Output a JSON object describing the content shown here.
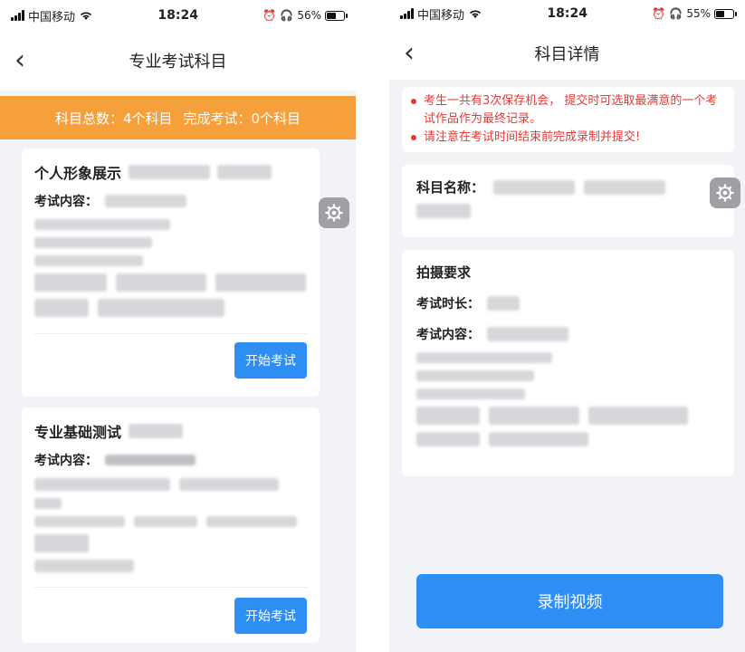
{
  "left": {
    "status": {
      "carrier": "中国移动",
      "time": "18:24",
      "battery": "56%",
      "battery_level": 0.56
    },
    "nav": {
      "title": "专业考试科目",
      "back_icon": "chevron-left-icon"
    },
    "summary": {
      "total": "科目总数：4个科目",
      "done": "完成考试：0个科目"
    },
    "subjects": [
      {
        "title": "个人形象展示",
        "content_label": "考试内容：",
        "start_label": "开始考试"
      },
      {
        "title": "专业基础测试",
        "content_label": "考试内容：",
        "start_label": "开始考试"
      }
    ]
  },
  "right": {
    "status": {
      "carrier": "中国移动",
      "time": "18:24",
      "battery": "55%",
      "battery_level": 0.55
    },
    "nav": {
      "title": "科目详情",
      "back_icon": "chevron-left-icon"
    },
    "notices": [
      "考生一共有3次保存机会， 提交时可选取最满意的一个考试作品作为最终记录。",
      "请注意在考试时间结束前完成录制并提交!"
    ],
    "subject_name_label": "科目名称：",
    "requirements": {
      "heading": "拍摄要求",
      "duration_label": "考试时长：",
      "content_label": "考试内容："
    },
    "record_button": "录制视频"
  },
  "colors": {
    "accent_blue": "#2f8ef4",
    "summary_orange": "#f5a03a",
    "notice_red": "#e53935"
  }
}
